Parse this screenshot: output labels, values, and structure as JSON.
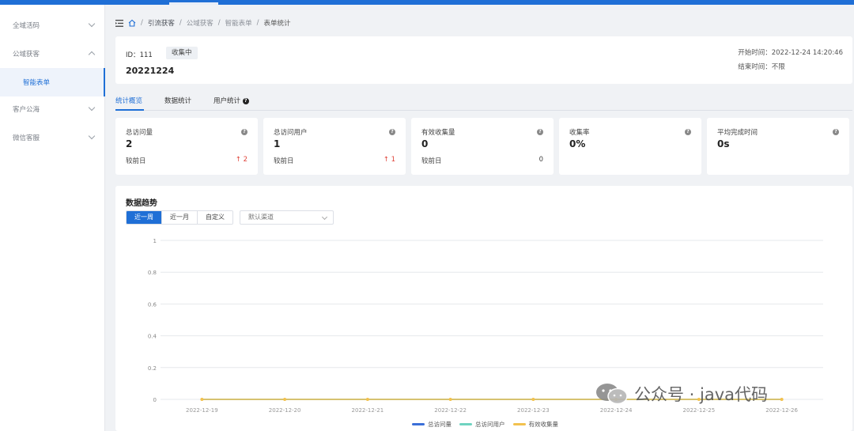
{
  "sidebar": {
    "items": [
      {
        "label": "全域活码"
      },
      {
        "label": "公域获客"
      },
      {
        "label": "智能表单"
      },
      {
        "label": "客户公海"
      },
      {
        "label": "微信客服"
      }
    ]
  },
  "breadcrumb": [
    "引流获客",
    "公域获客",
    "智能表单",
    "表单统计"
  ],
  "info": {
    "id_label": "ID：",
    "id_value": "111",
    "status": "收集中",
    "name": "20221224",
    "start_label": "开始时间：",
    "start_value": "2022-12-24 14:20:46",
    "end_label": "结束时间：",
    "end_value": "不限"
  },
  "tabs": [
    "统计概览",
    "数据统计",
    "用户统计"
  ],
  "stats": [
    {
      "label": "总访问量",
      "value": "2",
      "compare": "较前日",
      "delta": "↑ 2"
    },
    {
      "label": "总访问用户",
      "value": "1",
      "compare": "较前日",
      "delta": "↑ 1"
    },
    {
      "label": "有效收集量",
      "value": "0",
      "compare": "较前日",
      "delta": "0"
    },
    {
      "label": "收集率",
      "value": "0%"
    },
    {
      "label": "平均完成时间",
      "value": "0s"
    }
  ],
  "trend": {
    "title": "数据趋势",
    "ranges": [
      "近一周",
      "近一月",
      "自定义"
    ],
    "channel": "默认渠道"
  },
  "chart_data": {
    "type": "line",
    "x": [
      "2022-12-19",
      "2022-12-20",
      "2022-12-21",
      "2022-12-22",
      "2022-12-23",
      "2022-12-24",
      "2022-12-25",
      "2022-12-26"
    ],
    "series": [
      {
        "name": "总访问量",
        "values": [
          0,
          0,
          0,
          0,
          0,
          0,
          0,
          0
        ],
        "color": "#3b6fd8"
      },
      {
        "name": "总访问用户",
        "values": [
          0,
          0,
          0,
          0,
          0,
          0,
          0,
          0
        ],
        "color": "#6fd3c0"
      },
      {
        "name": "有效收集量",
        "values": [
          0,
          0,
          0,
          0,
          0,
          0,
          0,
          0
        ],
        "color": "#f2c14e"
      }
    ],
    "yticks": [
      "0",
      "0.2",
      "0.4",
      "0.6",
      "0.8",
      "1"
    ],
    "ylim": [
      0,
      1
    ],
    "grid": true,
    "legend": "bottom"
  },
  "watermark": "公众号 · java代码"
}
